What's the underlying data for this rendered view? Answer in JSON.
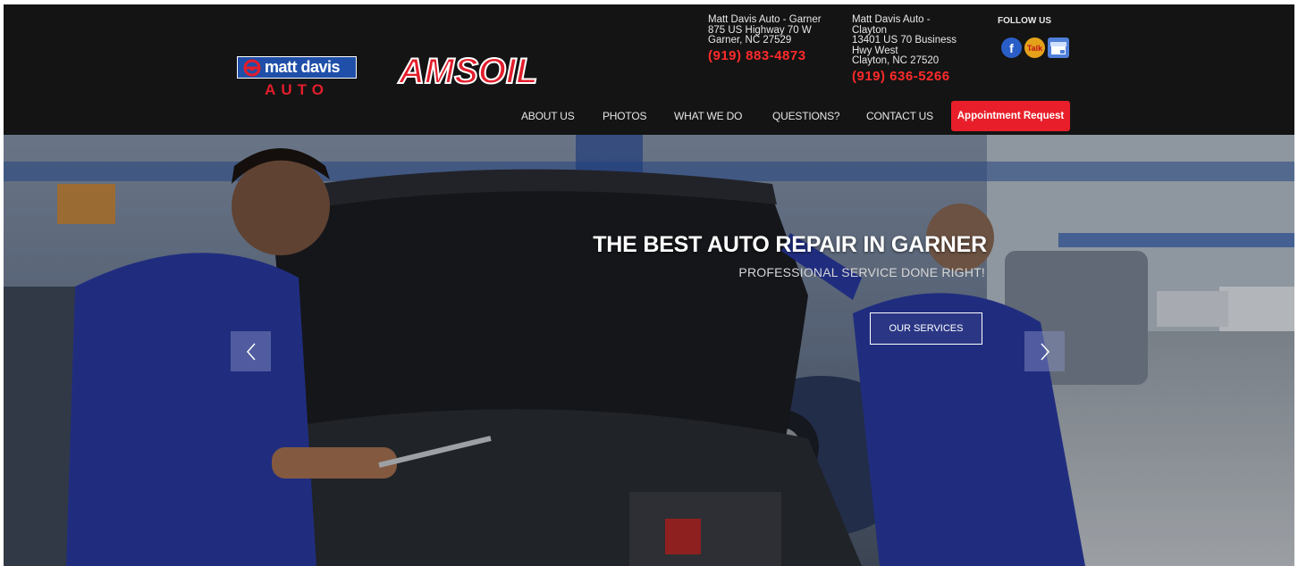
{
  "brand": {
    "logo_name": "matt davis",
    "logo_auto": "AUTO",
    "partner_logo": "AMSOIL"
  },
  "locations": {
    "garner": {
      "lines": [
        "Matt Davis Auto - Garner",
        "875 US Highway 70 W",
        "Garner, NC 27529"
      ],
      "phone": "(919) 883-4873"
    },
    "clayton": {
      "lines": [
        "Matt Davis Auto -",
        "Clayton",
        "13401 US 70 Business",
        "Hwy West",
        "Clayton, NC 27520"
      ],
      "phone": "(919) 636-5266"
    }
  },
  "social": {
    "label": "FOLLOW US",
    "icons": [
      "facebook-icon",
      "yelp-icon",
      "google-business-icon"
    ],
    "yelp_text": "Talk"
  },
  "nav": {
    "items": [
      "ABOUT US",
      "PHOTOS",
      "WHAT WE DO",
      "QUESTIONS?",
      "CONTACT US"
    ],
    "cta": "Appointment Request"
  },
  "hero": {
    "title": "THE BEST AUTO REPAIR IN GARNER",
    "subtitle": "PROFESSIONAL SERVICE DONE RIGHT!",
    "button": "OUR SERVICES"
  },
  "colors": {
    "header_bg": "#141414",
    "accent_red": "#e81f2a",
    "phone_red": "#ff2a2a",
    "logo_blue": "#1f4fa8"
  }
}
